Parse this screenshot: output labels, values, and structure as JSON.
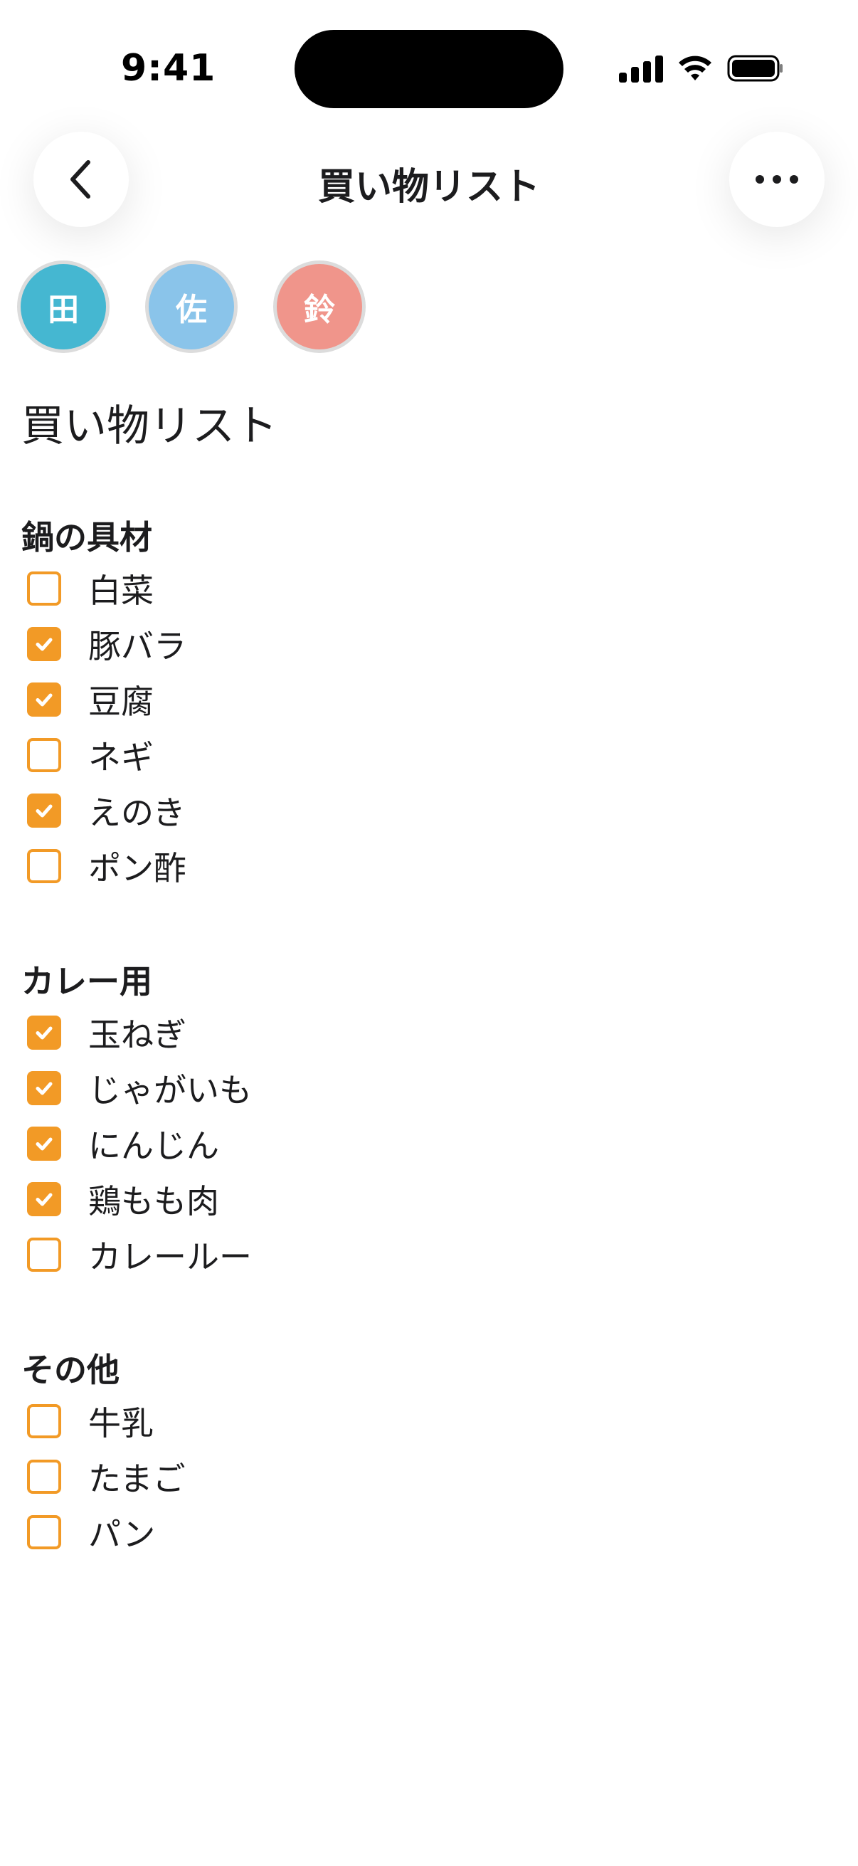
{
  "status_bar": {
    "time": "9:41"
  },
  "nav": {
    "title": "買い物リスト",
    "back_icon": "chevron-left-icon",
    "more_icon": "ellipsis-icon"
  },
  "avatars": [
    {
      "initial": "田",
      "color": "#45b7d1"
    },
    {
      "initial": "佐",
      "color": "#8ac4ea"
    },
    {
      "initial": "鈴",
      "color": "#f0958b"
    }
  ],
  "doc_title": "買い物リスト",
  "colors": {
    "accent": "#f29a26"
  },
  "sections": [
    {
      "title": "鍋の具材",
      "items": [
        {
          "label": "白菜",
          "checked": false
        },
        {
          "label": "豚バラ",
          "checked": true
        },
        {
          "label": "豆腐",
          "checked": true
        },
        {
          "label": "ネギ",
          "checked": false
        },
        {
          "label": "えのき",
          "checked": true
        },
        {
          "label": "ポン酢",
          "checked": false
        }
      ]
    },
    {
      "title": "カレー用",
      "items": [
        {
          "label": "玉ねぎ",
          "checked": true
        },
        {
          "label": "じゃがいも",
          "checked": true
        },
        {
          "label": "にんじん",
          "checked": true
        },
        {
          "label": "鶏もも肉",
          "checked": true
        },
        {
          "label": "カレールー",
          "checked": false
        }
      ]
    },
    {
      "title": "その他",
      "items": [
        {
          "label": "牛乳",
          "checked": false
        },
        {
          "label": "たまご",
          "checked": false
        },
        {
          "label": "パン",
          "checked": false
        }
      ]
    }
  ]
}
